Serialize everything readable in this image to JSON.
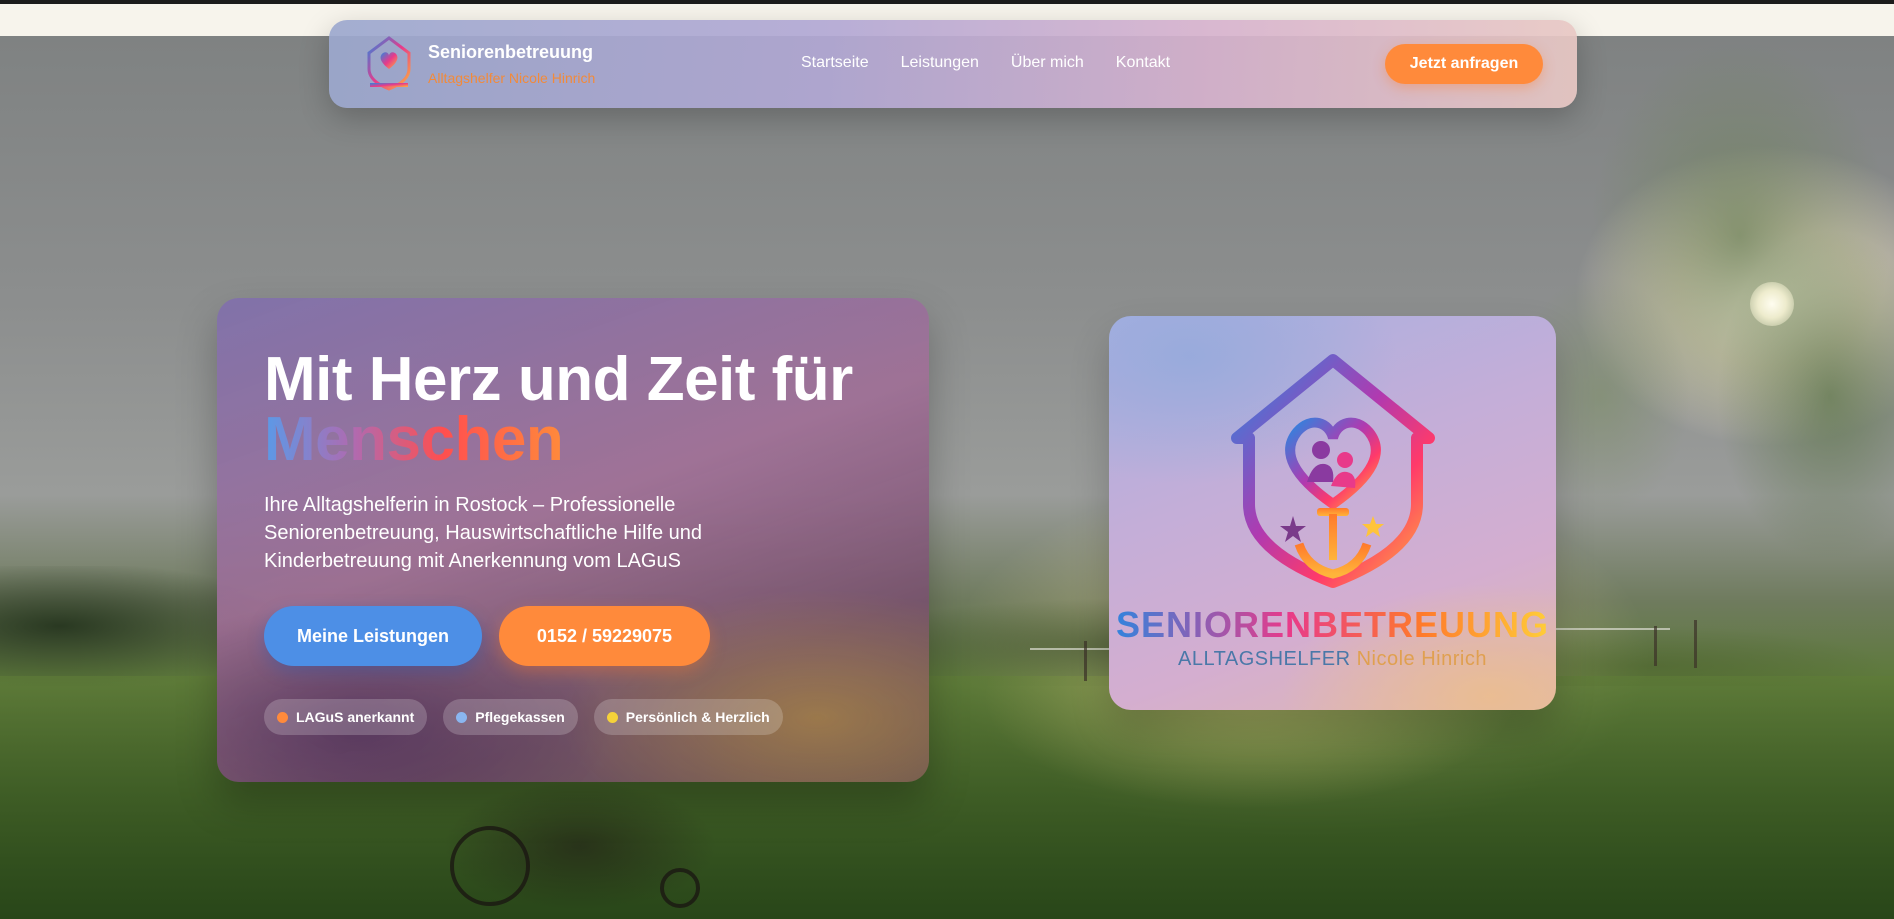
{
  "brand": {
    "title": "Seniorenbetreuung",
    "subtitle": "Alltagshelfer Nicole Hinrich"
  },
  "nav": {
    "links": [
      "Startseite",
      "Leistungen",
      "Über mich",
      "Kontakt"
    ],
    "cta": "Jetzt anfragen"
  },
  "hero": {
    "headline_line1": "Mit Herz und Zeit für",
    "headline_line2": "Menschen",
    "description": "Ihre Alltagshelferin in Rostock – Professionelle Seniorenbetreuung, Hauswirtschaftliche Hilfe und Kinderbetreuung mit Anerkennung vom LAGuS",
    "primary_button": "Meine Leistungen",
    "phone_button": "0152 / 59229075",
    "badges": [
      {
        "label": "LAGuS anerkannt",
        "color": "#ff8a3b"
      },
      {
        "label": "Pflegekassen",
        "color": "#8ab6f0"
      },
      {
        "label": "Persönlich & Herzlich",
        "color": "#f5d23a"
      }
    ]
  },
  "logo_card": {
    "wordmark": "SENIORENBETREUUNG",
    "sub_a": "ALLTAGSHELFER",
    "sub_b": "Nicole Hinrich"
  },
  "colors": {
    "accent_orange": "#ff8a3b",
    "accent_blue": "#4d8fe6"
  }
}
